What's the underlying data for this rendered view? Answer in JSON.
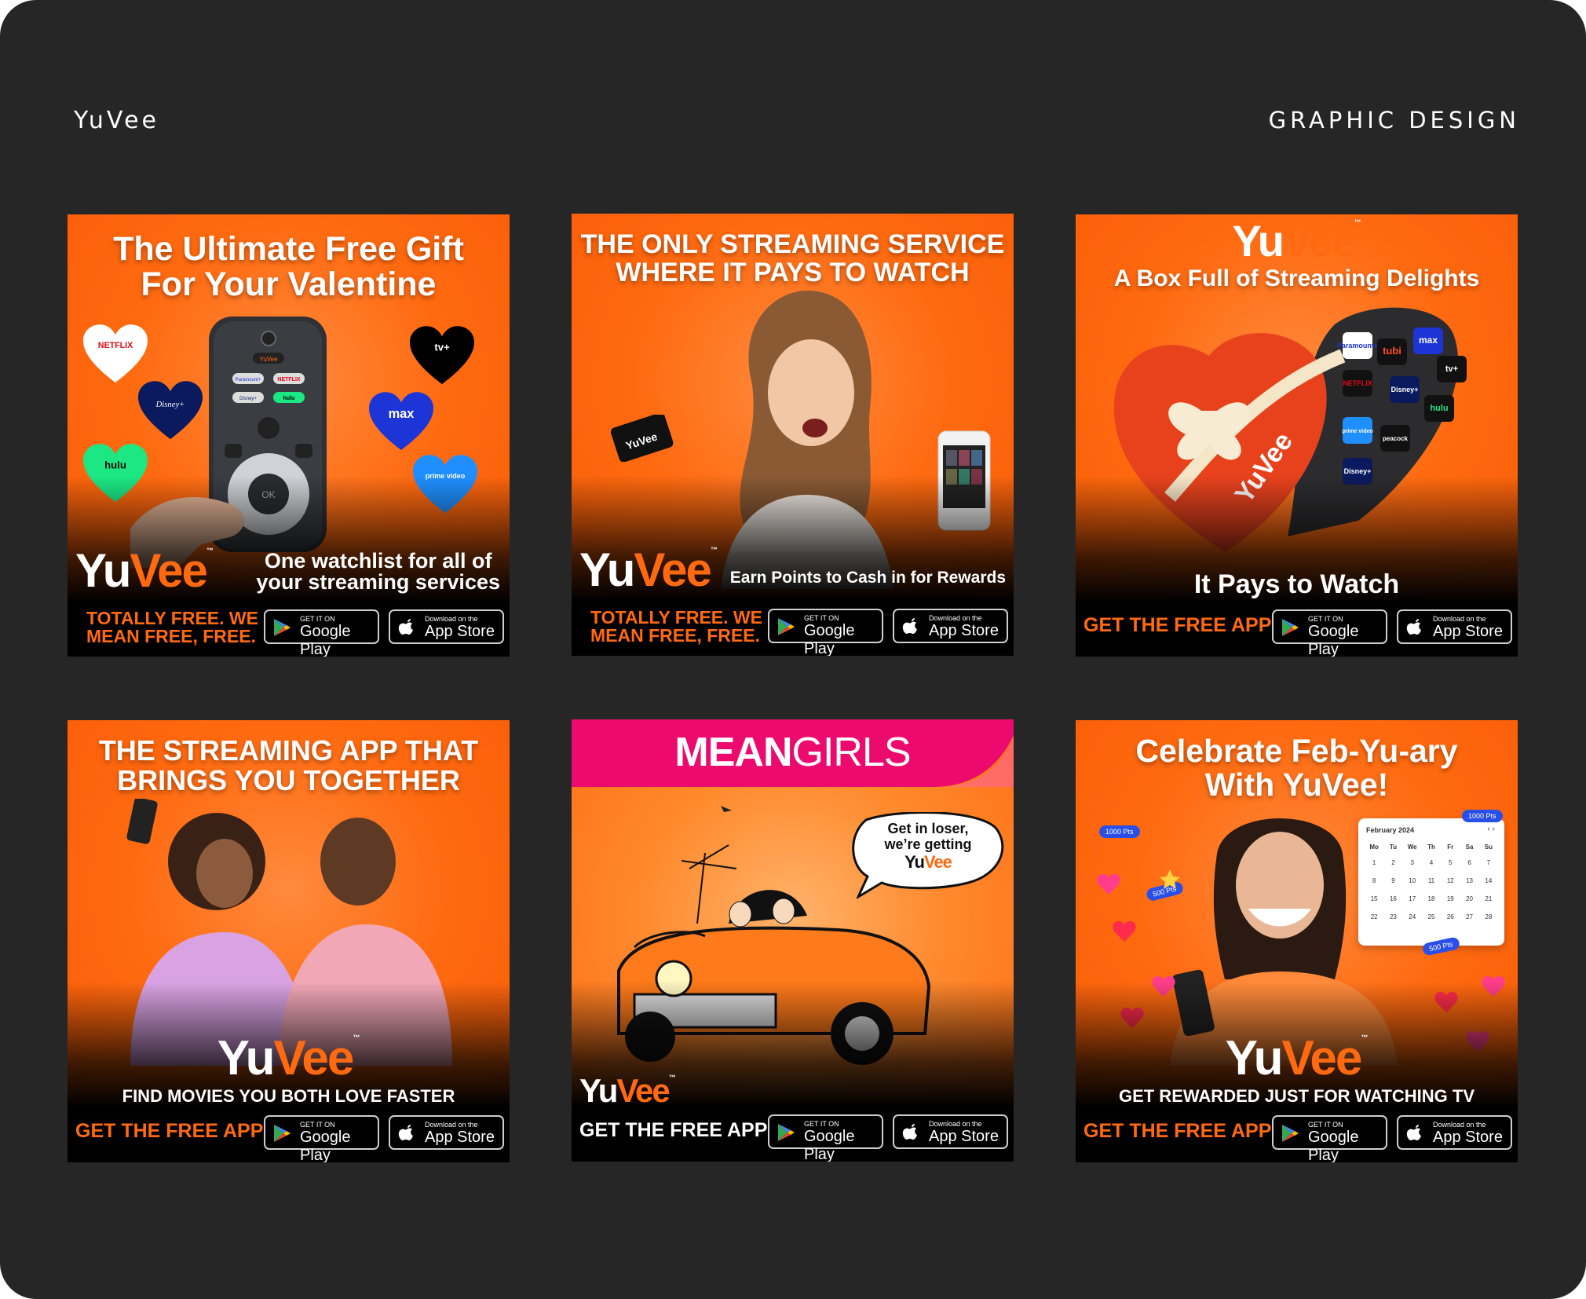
{
  "header": {
    "brand": "YuVee",
    "category": "GRAPHIC DESIGN"
  },
  "colors": {
    "accent": "#ff6a10",
    "frame": "#262626",
    "pink": "#ec0a6e"
  },
  "logo": {
    "yu": "Yu",
    "vee": "Vee",
    "tm": "™"
  },
  "stores": {
    "google_small": "GET IT ON",
    "google_big": "Google Play",
    "apple_small": "Download on the",
    "apple_big": "App Store"
  },
  "cards": {
    "c1": {
      "headline_1": "The Ultimate Free Gift",
      "headline_2": "For Your Valentine",
      "tagline_1": "One watchlist for all of",
      "tagline_2": "your streaming services",
      "cta_1": "TOTALLY FREE. WE",
      "cta_2": "MEAN FREE, FREE.",
      "hearts": [
        "NETFLIX",
        "Disney+",
        "hulu",
        "tv+",
        "max",
        "prime video"
      ],
      "remote_buttons": [
        "YuVee",
        "Paramount+",
        "NETFLIX",
        "Disney+",
        "hulu",
        "OK"
      ]
    },
    "c2": {
      "headline_1": "THE ONLY STREAMING SERVICE",
      "headline_2": "WHERE IT PAYS TO WATCH",
      "card_label": "YuVee",
      "tagline": "Earn Points to Cash in for Rewards",
      "cta_1": "TOTALLY FREE. WE",
      "cta_2": "MEAN FREE, FREE."
    },
    "c3": {
      "headline": "A Box Full of Streaming Delights",
      "box_label": "YuVee",
      "tiles": [
        "Paramount+",
        "tubi",
        "max",
        "tv+",
        "NETFLIX",
        "Disney+",
        "hulu",
        "prime video",
        "peacock",
        "Disney+"
      ],
      "tagline": "It Pays to Watch",
      "cta": "GET THE FREE APP!"
    },
    "c4": {
      "headline_1": "THE STREAMING APP THAT",
      "headline_2": "BRINGS YOU TOGETHER",
      "tagline": "FIND MOVIES YOU BOTH LOVE FASTER",
      "cta": "GET THE FREE APP!"
    },
    "c5": {
      "banner_1": "MEAN",
      "banner_2": "GIRLS",
      "bubble_1": "Get in loser,",
      "bubble_2": "we’re getting",
      "cta": "GET THE FREE APP!"
    },
    "c6": {
      "headline_1": "Celebrate Feb-Yu-ary",
      "headline_2": "With YuVee!",
      "calendar_title": "February 2024",
      "calendar_nav": "‹ ›",
      "weekdays": [
        "Mo",
        "Tu",
        "We",
        "Th",
        "Fr",
        "Sa",
        "Su"
      ],
      "days": [
        "1",
        "2",
        "3",
        "4",
        "5",
        "6",
        "7",
        "8",
        "9",
        "10",
        "11",
        "12",
        "13",
        "14",
        "15",
        "16",
        "17",
        "18",
        "19",
        "20",
        "21",
        "22",
        "23",
        "24",
        "25",
        "26",
        "27",
        "28"
      ],
      "points": [
        "1000 Pts",
        "1000 Pts",
        "500 Pts",
        "500 Pts"
      ],
      "tagline": "GET REWARDED JUST FOR WATCHING TV",
      "cta": "GET THE FREE APP!"
    }
  }
}
